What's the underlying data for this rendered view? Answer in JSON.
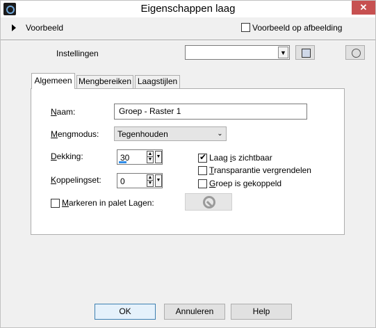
{
  "window": {
    "title": "Eigenschappen laag",
    "close_glyph": "✕"
  },
  "preview": {
    "label": "Voorbeeld",
    "on_image_label": "Voorbeeld op afbeelding",
    "on_image_checked": false
  },
  "settings": {
    "label": "Instellingen",
    "value": ""
  },
  "tabs": [
    {
      "label": "Algemeen",
      "active": true
    },
    {
      "label": "Mengbereiken",
      "active": false
    },
    {
      "label": "Laagstijlen",
      "active": false
    }
  ],
  "general": {
    "name_label": {
      "u": "N",
      "rest": "aam:"
    },
    "name_value": "Groep - Raster 1",
    "blend_label": {
      "u": "M",
      "rest": "engmodus:"
    },
    "blend_value": "Tegenhouden",
    "opacity_label": {
      "u": "D",
      "rest": "ekking:"
    },
    "opacity_value": "30",
    "opacity_fraction": 0.3,
    "link_label": {
      "u": "K",
      "rest": "oppelingset:"
    },
    "link_value": "0",
    "mark_label": {
      "pre": "",
      "u": "M",
      "rest": "arkeren in palet Lagen:"
    },
    "mark_checked": false,
    "visible": {
      "pre": "Laag ",
      "u": "i",
      "rest": "s zichtbaar",
      "checked": true
    },
    "lock_transparency": {
      "pre": "",
      "u": "T",
      "rest": "ransparantie vergrendelen",
      "checked": false
    },
    "group_linked": {
      "pre": "",
      "u": "G",
      "rest": "roep is gekoppeld",
      "checked": false
    }
  },
  "buttons": {
    "ok": "OK",
    "cancel": "Annuleren",
    "help": "Help"
  },
  "icons": {
    "app": "paintshop-icon",
    "expand": "triangle-right-icon",
    "save": "save-preset-icon",
    "reset": "reset-icon",
    "no_color": "no-color-icon"
  }
}
